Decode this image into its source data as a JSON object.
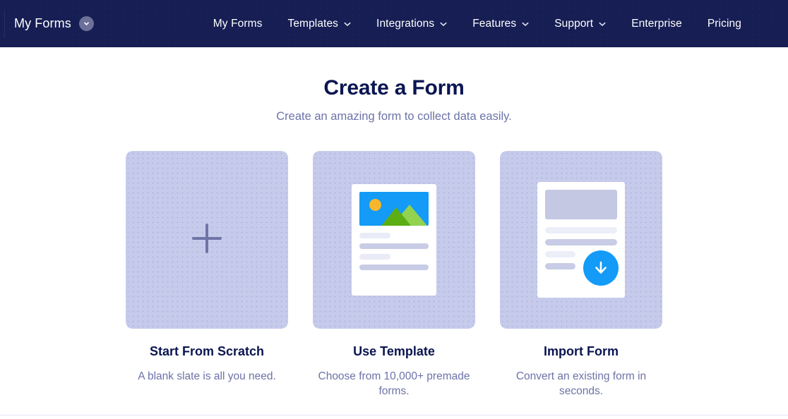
{
  "navbar": {
    "brand": {
      "label": "My Forms",
      "chevron_icon": "chevron-down-icon"
    },
    "menu": [
      {
        "label": "My Forms",
        "has_caret": false
      },
      {
        "label": "Templates",
        "has_caret": true
      },
      {
        "label": "Integrations",
        "has_caret": true
      },
      {
        "label": "Features",
        "has_caret": true
      },
      {
        "label": "Support",
        "has_caret": true
      },
      {
        "label": "Enterprise",
        "has_caret": false
      },
      {
        "label": "Pricing",
        "has_caret": false
      }
    ],
    "background_color": "#161e54",
    "text_color": "#ffffff"
  },
  "main": {
    "title": "Create a Form",
    "subtitle": "Create an amazing form to collect data easily.",
    "cards": [
      {
        "title": "Start From Scratch",
        "description": "A blank slate is all you need.",
        "icon": "plus-icon"
      },
      {
        "title": "Use Template",
        "description": "Choose from 10,000+ premade forms.",
        "icon": "document-with-image-icon"
      },
      {
        "title": "Import Form",
        "description": "Convert an existing form in seconds.",
        "icon": "document-download-icon"
      }
    ],
    "colors": {
      "tile_background": "#c6cbeb",
      "title_text": "#0a1551",
      "muted_text": "#6c73a8",
      "accent_blue": "#139bf7",
      "sun_orange": "#f8b62c",
      "mountain_dark_green": "#5cae15",
      "mountain_light_green": "#92d24f"
    }
  }
}
